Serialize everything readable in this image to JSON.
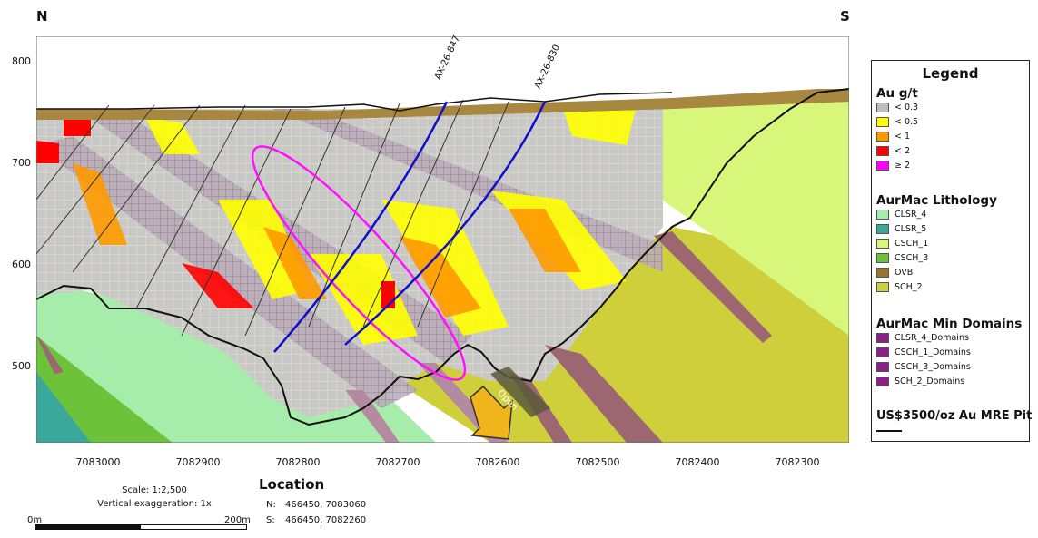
{
  "orientation": {
    "left": "N",
    "right": "S"
  },
  "y_axis_ticks": [
    "800",
    "700",
    "600",
    "500"
  ],
  "x_axis_ticks": [
    "7083000",
    "7082900",
    "7082800",
    "7082700",
    "7082600",
    "7082500",
    "7082400",
    "7082300"
  ],
  "drillholes": [
    {
      "label": "AX-26-847",
      "color": "#1010c8"
    },
    {
      "label": "AX-26-830",
      "color": "#1010c8"
    }
  ],
  "annotations": {
    "open": "Open"
  },
  "legend": {
    "title": "Legend",
    "au_section": "Au g/t",
    "au_items": [
      {
        "label": "< 0.3",
        "color": "#bdbdbd"
      },
      {
        "label": "< 0.5",
        "color": "#ffff00"
      },
      {
        "label": "< 1",
        "color": "#ff9900"
      },
      {
        "label": "< 2",
        "color": "#ff0000"
      },
      {
        "label": "≥ 2",
        "color": "#ff00ff"
      }
    ],
    "lith_section": "AurMac Lithology",
    "lith_items": [
      {
        "label": "CLSR_4",
        "color": "#a6ecaa"
      },
      {
        "label": "CLSR_5",
        "color": "#3aa89a"
      },
      {
        "label": "CSCH_1",
        "color": "#d8f77a"
      },
      {
        "label": "CSCH_3",
        "color": "#6cc33a"
      },
      {
        "label": "OVB",
        "color": "#9a7330"
      },
      {
        "label": "SCH_2",
        "color": "#cfcf3c"
      }
    ],
    "min_section": "AurMac Min Domains",
    "min_items": [
      {
        "label": "CLSR_4_Domains",
        "color": "#8a1f8a"
      },
      {
        "label": "CSCH_1_Domains",
        "color": "#8a1f8a"
      },
      {
        "label": "CSCH_3_Domains",
        "color": "#8a1f8a"
      },
      {
        "label": "SCH_2_Domains",
        "color": "#8a1f8a"
      }
    ],
    "pit_label": "US$3500/oz Au MRE Pit"
  },
  "scale": {
    "scale_text": "Scale: 1:2,500",
    "vert_exag": "Vertical exaggeration: 1x",
    "bar_start": "0m",
    "bar_end": "200m"
  },
  "location": {
    "title": "Location",
    "n_label": "N:",
    "n_value": "466450, 7083060",
    "s_label": "S:",
    "s_value": "466450, 7082260"
  }
}
